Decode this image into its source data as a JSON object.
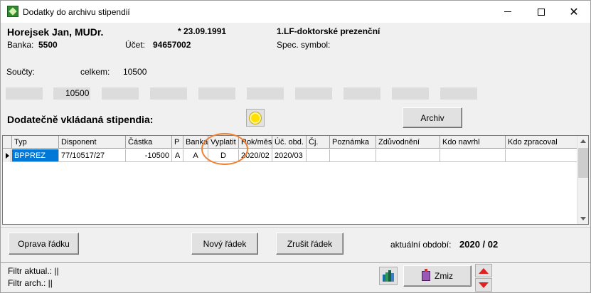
{
  "window": {
    "title": "Dodatky do archivu stipendií"
  },
  "header": {
    "name": "Horejsek Jan, MUDr.",
    "birth": "* 23.09.1991",
    "program": "1.LF-doktorské prezenční",
    "bank_label": "Banka:",
    "bank_value": "5500",
    "account_label": "Účet:",
    "account_value": "94657002",
    "spec_symbol_label": "Spec. symbol:"
  },
  "sums": {
    "label": "Součty:",
    "total_label": "celkem:",
    "total_value": "10500",
    "box_value": "10500"
  },
  "section": {
    "title": "Dodatečně vkládaná stipendia:",
    "archive_button": "Archiv"
  },
  "grid": {
    "columns": [
      "Typ",
      "Disponent",
      "Částka",
      "P",
      "Banka",
      "Vyplatit",
      "Rok/měs.",
      "Úč. obd.",
      "Čj.",
      "Poznámka",
      "Zdůvodnění",
      "Kdo navrhl",
      "Kdo zpracoval"
    ],
    "rows": [
      [
        "BPPREZ",
        "77/10517/27",
        "-10500",
        "A",
        "A",
        "D",
        "2020/02",
        "2020/03",
        "",
        "",
        "",
        "",
        ""
      ]
    ]
  },
  "actions": {
    "fix_row": "Oprava řádku",
    "new_row": "Nový řádek",
    "cancel_row": "Zrušit řádek",
    "period_label": "aktuální období:",
    "period_value": "2020 / 02"
  },
  "status": {
    "filter_current": "Filtr aktual.: ||",
    "filter_archive": "Filtr arch.: ||",
    "zmiz_button": "Zmiz"
  },
  "icons": {
    "app": "app-icon",
    "sun": "sun-icon",
    "books": "books-icon",
    "zmiz": "zmiz-icon",
    "up": "arrow-up-icon",
    "down": "arrow-down-icon"
  },
  "colors": {
    "selection": "#0078d7",
    "highlight_ring": "#f08030",
    "arrows": "#e02020"
  }
}
